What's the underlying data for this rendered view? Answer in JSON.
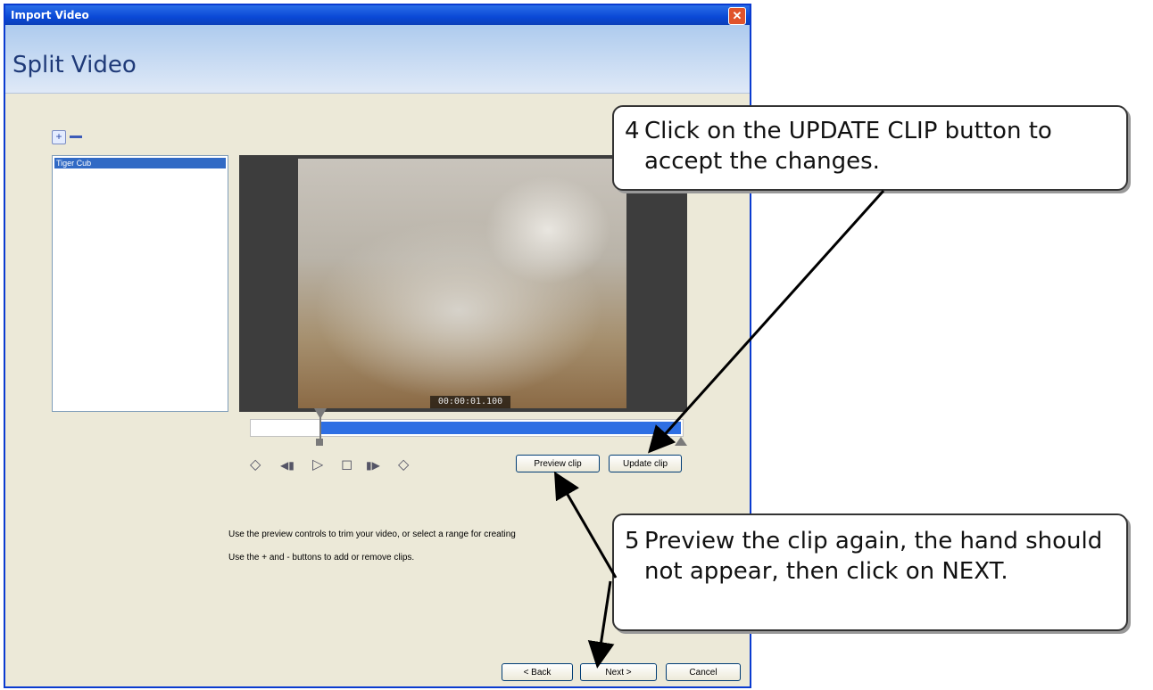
{
  "window": {
    "title": "Import Video",
    "close_glyph": "✕",
    "heading": "Split Video"
  },
  "clips": {
    "add_glyph": "+",
    "items": [
      "Tiger Cub"
    ]
  },
  "video": {
    "timestamp": "00:00:01.100"
  },
  "playback": {
    "controls": [
      {
        "name": "mark-start-icon",
        "glyph": "◇"
      },
      {
        "name": "step-back-icon",
        "glyph": "◀▮"
      },
      {
        "name": "play-icon",
        "glyph": "▷"
      },
      {
        "name": "stop-icon",
        "glyph": "◻"
      },
      {
        "name": "step-forward-icon",
        "glyph": "▮▶"
      },
      {
        "name": "mark-end-icon",
        "glyph": "◇"
      }
    ],
    "preview_button": "Preview clip",
    "update_button": "Update clip"
  },
  "help": {
    "line1": "Use the preview controls to trim your video, or select a range for creating",
    "line2": "Use the + and - buttons to add or remove clips."
  },
  "footer": {
    "back": "< Back",
    "next": "Next >",
    "cancel": "Cancel"
  },
  "callouts": {
    "c4": {
      "num": "4",
      "text": "Click on the UPDATE CLIP button to accept the changes."
    },
    "c5": {
      "num": "5",
      "text": "Preview the clip again, the hand should not appear, then click on NEXT."
    }
  }
}
